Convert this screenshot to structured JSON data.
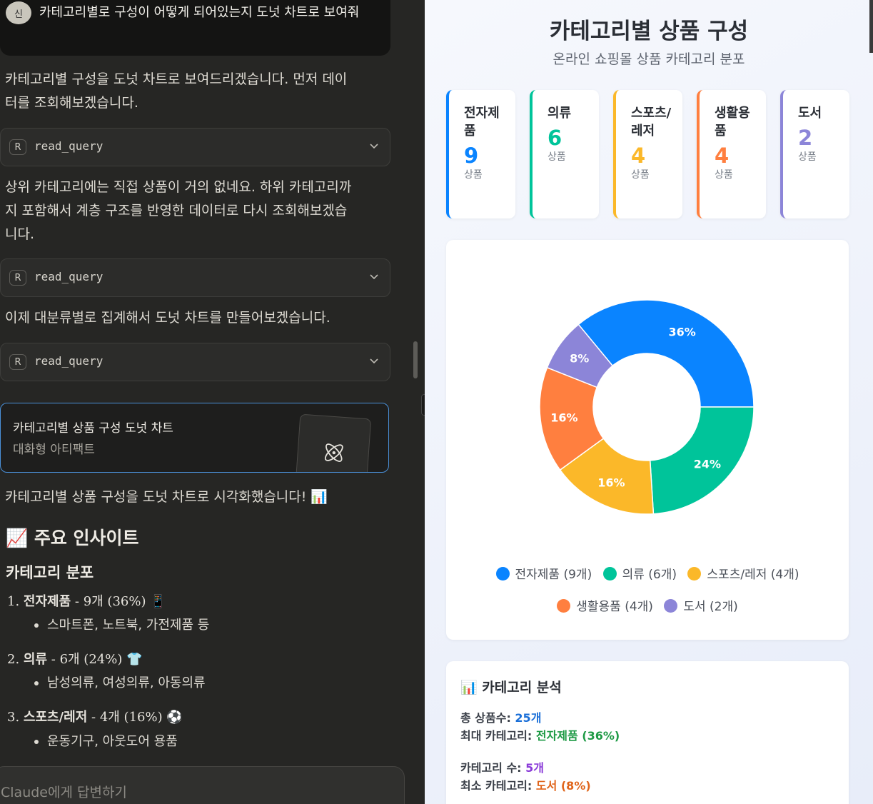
{
  "chat": {
    "user_avatar": "신",
    "user_message": "카테고리별로 구성이 어떻게 되어있는지 도넛 차트로 보여줘",
    "para1": "카테고리별 구성을 도넛 차트로 보여드리겠습니다. 먼저 데이터를 조회해보겠습니다.",
    "tool_icon": "R",
    "tool_name": "read_query",
    "para2": "상위 카테고리에는 직접 상품이 거의 없네요. 하위 카테고리까지 포함해서 계층 구조를 반영한 데이터로 다시 조회해보겠습니다.",
    "para3": "이제 대분류별로 집계해서 도넛 차트를 만들어보겠습니다.",
    "artifact_title": "카테고리별 상품 구성 도넛 차트",
    "artifact_subtitle": "대화형 아티팩트",
    "para4": "카테고리별 상품 구성을 도넛 차트로 시각화했습니다! 📊",
    "insight_heading": "📈 주요 인사이트",
    "dist_heading": "카테고리 분포",
    "list": [
      {
        "num": "1.",
        "name": "전자제품",
        "detail": " - 9개 (36%) 📱",
        "sub": "스마트폰, 노트북, 가전제품 등"
      },
      {
        "num": "2.",
        "name": "의류",
        "detail": " - 6개 (24%) 👕",
        "sub": "남성의류, 여성의류, 아동의류"
      },
      {
        "num": "3.",
        "name": "스포츠/레저",
        "detail": " - 4개 (16%) ⚽",
        "sub": "운동기구, 아웃도어 용품"
      }
    ],
    "reply_placeholder": "Claude에게 답변하기"
  },
  "artifact": {
    "title": "카테고리별 상품 구성",
    "subtitle": "온라인 쇼핑몰 상품 카테고리 분포",
    "unit": "상품",
    "cards": [
      {
        "name": "전자제품",
        "count": "9",
        "color": "#0a84ff"
      },
      {
        "name": "의류",
        "count": "6",
        "color": "#00c49a"
      },
      {
        "name": "스포츠/레저",
        "count": "4",
        "color": "#fbb829"
      },
      {
        "name": "생활용품",
        "count": "4",
        "color": "#ff7f3f"
      },
      {
        "name": "도서",
        "count": "2",
        "color": "#8c85d8"
      }
    ],
    "legend": [
      "전자제품 (9개)",
      "의류 (6개)",
      "스포츠/레저 (4개)",
      "생활용품 (4개)",
      "도서 (2개)"
    ],
    "analysis": {
      "title": "📊 카테고리 분석",
      "total_label": "총 상품수: ",
      "total_value": "25개",
      "max_label": "최대 카테고리: ",
      "max_value": "전자제품 (36%)",
      "count_label": "카테고리 수: ",
      "count_value": "5개",
      "min_label": "최소 카테고리: ",
      "min_value": "도서 (8%)"
    }
  },
  "chart_data": {
    "type": "pie",
    "categories": [
      "전자제품",
      "의류",
      "스포츠/레저",
      "생활용품",
      "도서"
    ],
    "values": [
      9,
      6,
      4,
      4,
      2
    ],
    "percent_labels": [
      "36%",
      "24%",
      "16%",
      "16%",
      "8%"
    ],
    "colors": [
      "#0a84ff",
      "#00c49a",
      "#fbb829",
      "#ff7f3f",
      "#8c85d8"
    ],
    "donut": true,
    "legend_position": "bottom"
  }
}
